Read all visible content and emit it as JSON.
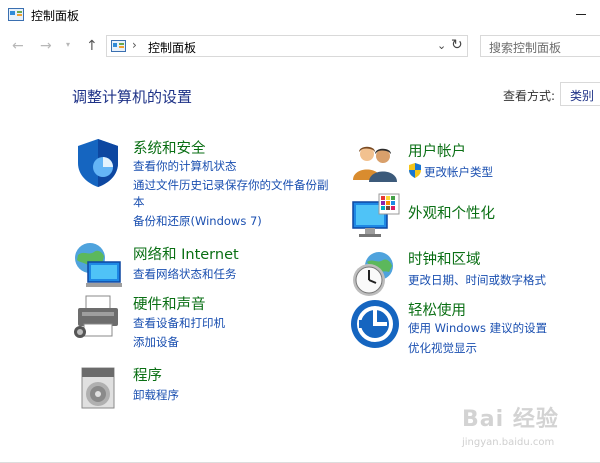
{
  "window": {
    "title": "控制面板"
  },
  "nav": {
    "breadcrumb": "控制面板"
  },
  "search": {
    "placeholder": "搜索控制面板"
  },
  "heading": "调整计算机的设置",
  "viewby": {
    "label": "查看方式:",
    "value": "类别"
  },
  "categories": {
    "system": {
      "title": "系统和安全",
      "links": [
        "查看你的计算机状态",
        "通过文件历史记录保存你的文件备份副",
        "本",
        "备份和还原(Windows 7)"
      ]
    },
    "network": {
      "title": "网络和 Internet",
      "links": [
        "查看网络状态和任务"
      ]
    },
    "hardware": {
      "title": "硬件和声音",
      "links": [
        "查看设备和打印机",
        "添加设备"
      ]
    },
    "programs": {
      "title": "程序",
      "links": [
        "卸载程序"
      ]
    },
    "users": {
      "title": "用户帐户",
      "links": [
        "更改帐户类型"
      ]
    },
    "appearance": {
      "title": "外观和个性化",
      "links": []
    },
    "clock": {
      "title": "时钟和区域",
      "links": [
        "更改日期、时间或数字格式"
      ]
    },
    "ease": {
      "title": "轻松使用",
      "links": [
        "使用 Windows 建议的设置",
        "优化视觉显示"
      ]
    }
  },
  "watermark": {
    "text": "Bai 经验",
    "url": "jingyan.baidu.com"
  },
  "colors": {
    "category_title": "#0a6f14",
    "link": "#1a4fb0",
    "heading": "#1e3287"
  },
  "icons": [
    "control-panel-icon",
    "back-arrow-icon",
    "forward-arrow-icon",
    "up-arrow-icon",
    "refresh-icon",
    "shield-icon",
    "globe-network-icon",
    "printer-icon",
    "programs-icon",
    "users-icon",
    "monitor-palette-icon",
    "clock-globe-icon",
    "ease-of-access-icon"
  ]
}
